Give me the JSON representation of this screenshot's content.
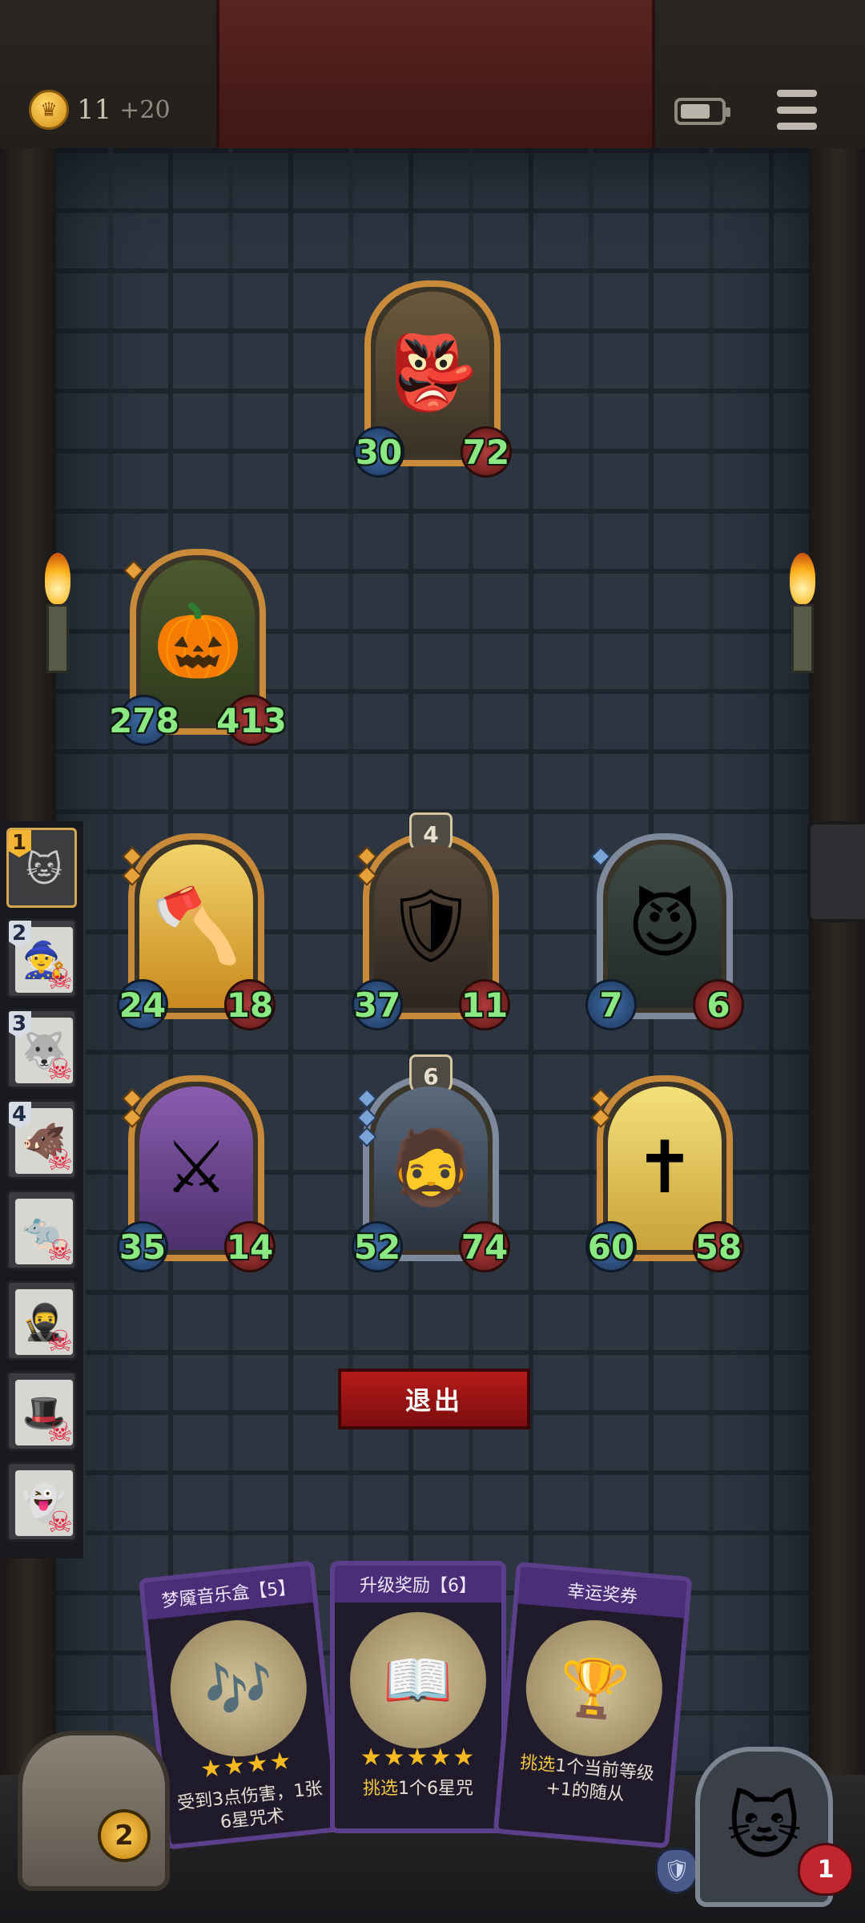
{
  "hud": {
    "coins": "11",
    "coin_bonus": "+20",
    "coin_icon_glyph": "♛",
    "battery_level": 0.75
  },
  "enemies": [
    {
      "name": "goblin-witch",
      "attack": "30",
      "health": "72",
      "glyph": "👺"
    },
    {
      "name": "pumpkin-ghost",
      "attack": "278",
      "health": "413",
      "glyph": "🎃"
    }
  ],
  "board": [
    {
      "name": "berserker",
      "attack": "24",
      "health": "18",
      "level": "",
      "glyph": "🪓"
    },
    {
      "name": "dark-knight",
      "attack": "37",
      "health": "11",
      "level": "4",
      "glyph": "🛡"
    },
    {
      "name": "succubus",
      "attack": "7",
      "health": "6",
      "level": "",
      "glyph": "😈"
    },
    {
      "name": "shield-soldier",
      "attack": "35",
      "health": "14",
      "level": "",
      "glyph": "⚔"
    },
    {
      "name": "dwarf-warrior",
      "attack": "52",
      "health": "74",
      "level": "6",
      "glyph": "🧔"
    },
    {
      "name": "holy-shield",
      "attack": "60",
      "health": "58",
      "level": "",
      "glyph": "✝"
    }
  ],
  "roster": [
    {
      "rank": "1",
      "active": true,
      "glyph": "🐱",
      "defeated": false
    },
    {
      "rank": "2",
      "active": false,
      "glyph": "🧙",
      "defeated": true
    },
    {
      "rank": "3",
      "active": false,
      "glyph": "🐺",
      "defeated": true
    },
    {
      "rank": "4",
      "active": false,
      "glyph": "🐗",
      "defeated": true
    },
    {
      "rank": "",
      "active": false,
      "glyph": "🐀",
      "defeated": true
    },
    {
      "rank": "",
      "active": false,
      "glyph": "🥷",
      "defeated": true
    },
    {
      "rank": "",
      "active": false,
      "glyph": "🎩",
      "defeated": true
    },
    {
      "rank": "",
      "active": false,
      "glyph": "👻",
      "defeated": true
    }
  ],
  "exit_label": "退出",
  "rewards": [
    {
      "title": "梦魇音乐盒【5】",
      "stars": "★★★★",
      "desc": "受到3点伤害，1张6星咒术",
      "desc_highlight": "",
      "glyph": "🎶"
    },
    {
      "title": "升级奖励【6】",
      "stars": "★★★★★",
      "desc": "1个6星咒",
      "desc_highlight": "挑选",
      "glyph": "📖"
    },
    {
      "title": "幸运奖券",
      "stars": "",
      "desc": "1个当前等级+1的随从",
      "desc_highlight": "挑选",
      "glyph": "🏆"
    }
  ],
  "player": {
    "chest_count": "2",
    "health": "1",
    "hero_glyph": "🐱",
    "shield_icon": "🛡"
  },
  "colors": {
    "attack_text": "#8ce882",
    "gold_frame": "#c98a3a",
    "silver_frame": "#7e8a9c",
    "exit_button": "#b51b1b"
  }
}
